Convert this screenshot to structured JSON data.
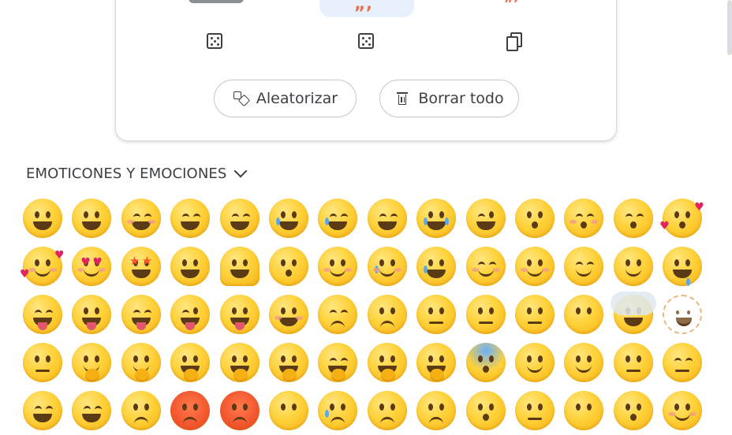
{
  "top_card": {
    "slot_fragments": {
      "middle": "„‚",
      "right": "„‚"
    },
    "controls": [
      {
        "name": "randomize-left-dice-icon"
      },
      {
        "name": "randomize-right-dice-icon"
      },
      {
        "name": "copy-icon"
      }
    ],
    "randomize_label": "Aleatorizar",
    "clear_all_label": "Borrar todo"
  },
  "section": {
    "title": "EMOTICONES Y EMOCIONES",
    "expand_icon": "chevron-down-icon"
  },
  "colors": {
    "card_border": "#dadce0",
    "selected_slot_bg": "#e8f0fe",
    "accent_fragment": "#e8734a",
    "emoji_yellow": "#ffd23a"
  },
  "emoji_rows": [
    [
      "grinning-face",
      "grinning-face-big-eyes",
      "grinning-face-smiling-eyes",
      "beaming-face",
      "grinning-squinting-face",
      "grinning-face-sweat",
      "face-tears-of-joy",
      "rolling-on-floor-laughing",
      "loudly-crying-face",
      "winking-face",
      "kissing-face",
      "kissing-face-smiling-eyes",
      "kissing-face-closed-eyes",
      "face-blowing-kiss"
    ],
    [
      "smiling-face-hearts",
      "smiling-face-heart-eyes",
      "star-struck",
      "partying-face",
      "melting-face",
      "upside-down-face",
      "slightly-smiling-face",
      "smiling-face-tear",
      "face-holding-back-tears",
      "smiling-face-smiling-eyes",
      "smiling-face",
      "relieved-face",
      "smirking-face",
      "drooling-face"
    ],
    [
      "face-savoring-food",
      "face-with-tongue",
      "squinting-face-tongue",
      "winking-face-tongue",
      "zany-face",
      "woozy-face",
      "pensive-face",
      "pleading-face",
      "grimacing-face",
      "expressionless-face",
      "neutral-face",
      "face-without-mouth",
      "face-in-clouds",
      "dotted-line-face"
    ],
    [
      "zipper-mouth-face",
      "saluting-face",
      "thinking-face",
      "shushing-face",
      "face-hand-over-mouth",
      "face-open-eyes-hand-over-mouth",
      "yawning-face",
      "hugging-face",
      "face-peeking-eye",
      "face-screaming-in-fear",
      "face-raised-eyebrow",
      "face-with-monocle",
      "unamused-face",
      "face-rolling-eyes"
    ],
    [
      "persevering-face",
      "confounded-face",
      "frowning-face",
      "angry-face",
      "pouting-face",
      "face-no-mouth",
      "downcast-face-sweat",
      "worried-face",
      "anxious-face",
      "hushed-face",
      "neutral-face-2",
      "face-without-mouth-2",
      "face-exhaling",
      "smiling-face-2"
    ]
  ]
}
